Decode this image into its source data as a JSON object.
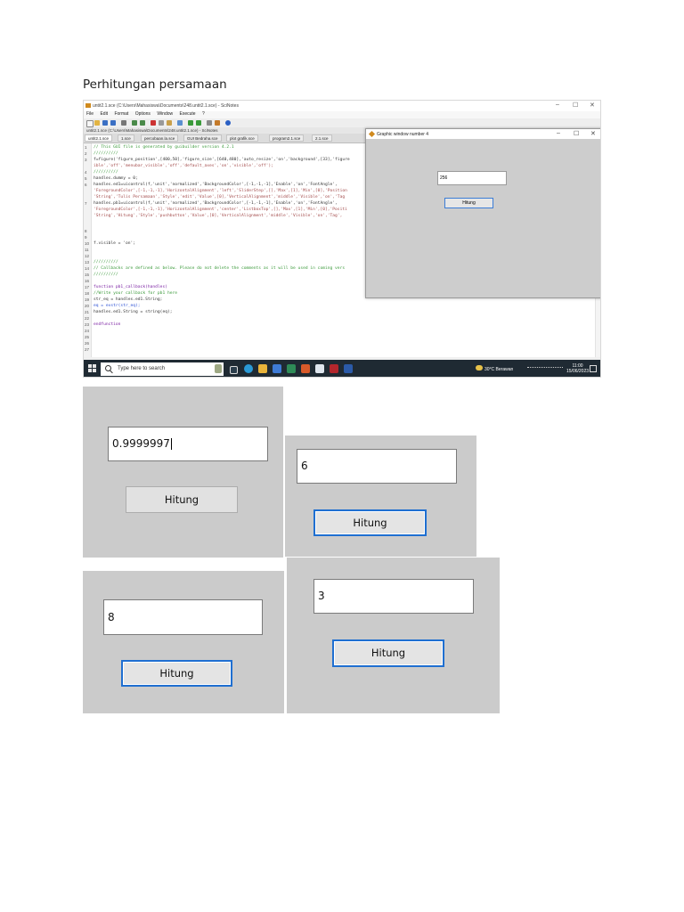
{
  "doc_title": "Perhitungan persamaan",
  "scinotes": {
    "window_title": "untit2.1.sce (C:\\Users\\Mahasiswa\\Documents\\248.untit2.1.sce) - SciNotes",
    "menu": [
      "File",
      "Edit",
      "Format",
      "Options",
      "Window",
      "Execute",
      "?"
    ],
    "path_bar": "untit2.1.sce (C:\\Users\\Mahasiswa\\Documents\\248.untit2.1.sce) - SciNotes",
    "tabs": [
      "untit2.1.sce",
      "1.sce",
      "percobaan.la.sce",
      "GUI Bedraha.sce",
      "plot grafik.sce",
      "program2.1.sce",
      "2.1.sce"
    ],
    "line_numbers": [
      "1",
      "2",
      "3",
      "",
      "4",
      "5",
      "6",
      "",
      "7",
      "",
      "8",
      "9",
      "10",
      "11",
      "12",
      "13",
      "14",
      "15",
      "16",
      "17",
      "18",
      "19",
      "20",
      "21",
      "22",
      "23",
      "24",
      "25",
      "26",
      "27"
    ],
    "code_lines": [
      "// This GUI file is generated by guibuilder version 4.2.1",
      "//////////",
      "f=figure('figure_position',[400,50],'figure_size',[640,480],'auto_resize','on','background',[33],'figure",
      "ible','off','menubar_visible','off','default_axes','on','visible','off');",
      "//////////",
      "handles.dummy = 0;",
      "handles.ed1=uicontrol(f,'unit','normalized','BackgroundColor',[-1,-1,-1],'Enable','on','FontAngle',",
      "'ForegroundColor',[-1,-1,-1],'HorizontalAlignment','left','SliderStep',[],'Max',[1],'Min',[0],'Position",
      "'String','Tulis Persamaan','Style','edit','Value',[0],'VerticalAlignment','middle','Visible','on','Tag",
      "handles.pb1=uicontrol(f,'unit','normalized','BackgroundColor',[-1,-1,-1],'Enable','on','FontAngle',",
      "'ForegroundColor',[-1,-1,-1],'HorizontalAlignment','center','ListboxTop',[],'Max',[1],'Min',[0],'Positi",
      "'String','Hitung','Style','pushbutton','Value',[0],'VerticalAlignment','middle','Visible','on','Tag',",
      "f.visible = 'on';",
      "//////////",
      "// Callbacks are defined as below. Please do not delete the comments as it will be used in coming vers",
      "//////////",
      "function pb1_callback(handles)",
      "//Write your callback for  pb1  here",
      "str_eq = handles.ed1.String;",
      "eq = evstr(str_eq);",
      "handles.ed1.String = string(eq);",
      "endfunction"
    ]
  },
  "graphic_window": {
    "title": "Graphic window number 4",
    "field_value": "256",
    "button_label": "Hitung"
  },
  "taskbar": {
    "search_placeholder": "Type here to search",
    "weather": "30°C  Berawan",
    "time": "11:00",
    "date": "15/06/2023"
  },
  "panels": [
    {
      "value": "0.9999997",
      "button": "Hitung"
    },
    {
      "value": "6",
      "button": "Hitung"
    },
    {
      "value": "8",
      "button": "Hitung"
    },
    {
      "value": "3",
      "button": "Hitung"
    }
  ],
  "window_controls": {
    "minimize": "–",
    "maximize": "☐",
    "close": "✕"
  }
}
